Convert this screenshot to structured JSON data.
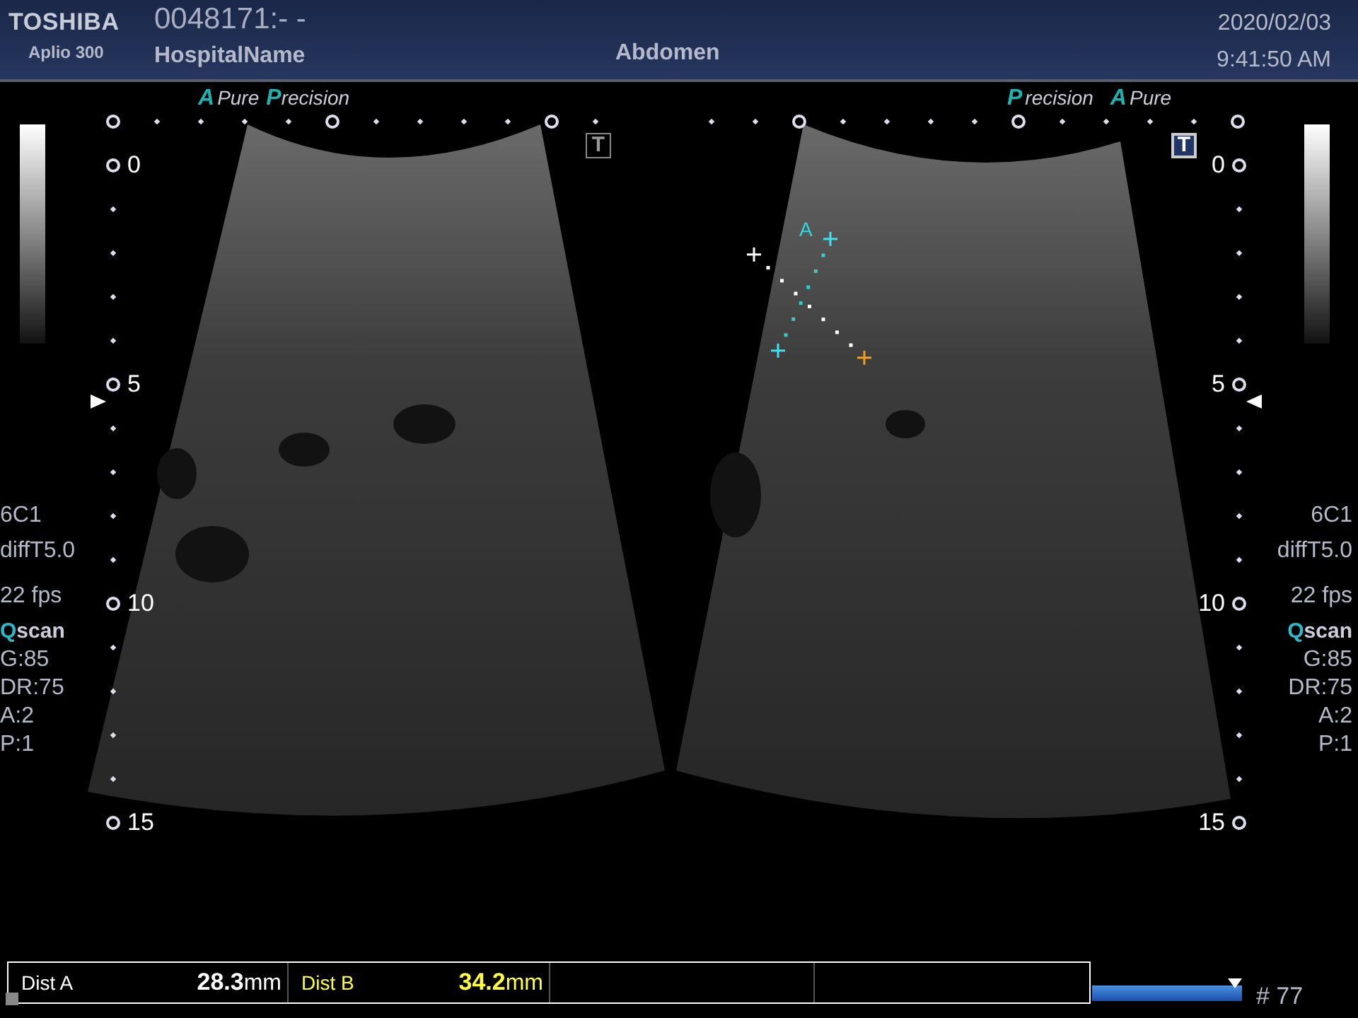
{
  "header": {
    "brand": "TOSHIBA",
    "model": "Aplio 300",
    "patient_id": "0048171:- -",
    "hospital": "HospitalName",
    "exam": "Abdomen",
    "date": "2020/02/03",
    "time": "9:41:50 AM"
  },
  "panels": [
    {
      "logo": [
        {
          "initial": "A",
          "word": "Pure"
        },
        {
          "initial": "P",
          "word": "recision"
        }
      ],
      "t_marker": {
        "label": "T",
        "active": false
      },
      "depths": [
        "0",
        "5",
        "10",
        "15"
      ],
      "params": [
        {
          "kind": "plain",
          "text": "6C1"
        },
        {
          "kind": "plain",
          "text": "diffT5.0"
        },
        {
          "kind": "plain",
          "text": "22 fps"
        },
        {
          "kind": "qscan",
          "initial": "Q",
          "rest": "scan"
        },
        {
          "kind": "plain",
          "text": "G:85"
        },
        {
          "kind": "plain",
          "text": "DR:75"
        },
        {
          "kind": "plain",
          "text": "A:2"
        },
        {
          "kind": "plain",
          "text": "P:1"
        }
      ]
    },
    {
      "logo": [
        {
          "initial": "P",
          "word": "recision"
        },
        {
          "initial": "A",
          "word": "Pure"
        }
      ],
      "t_marker": {
        "label": "T",
        "active": true
      },
      "depths": [
        "0",
        "5",
        "10",
        "15"
      ],
      "params": [
        {
          "kind": "plain",
          "text": "6C1"
        },
        {
          "kind": "plain",
          "text": "diffT5.0"
        },
        {
          "kind": "plain",
          "text": "22 fps"
        },
        {
          "kind": "qscan",
          "initial": "Q",
          "rest": "scan"
        },
        {
          "kind": "plain",
          "text": "G:85"
        },
        {
          "kind": "plain",
          "text": "DR:75"
        },
        {
          "kind": "plain",
          "text": "A:2"
        },
        {
          "kind": "plain",
          "text": "P:1"
        }
      ],
      "caliper_label": "A"
    }
  ],
  "measurements": [
    {
      "label": "Dist A",
      "value": "28.3",
      "unit": "mm",
      "color": "#ffffff"
    },
    {
      "label": "Dist B",
      "value": "34.2",
      "unit": "mm",
      "color": "#ffff40"
    }
  ],
  "cine": {
    "level": 1.0,
    "frame": "# 77"
  }
}
